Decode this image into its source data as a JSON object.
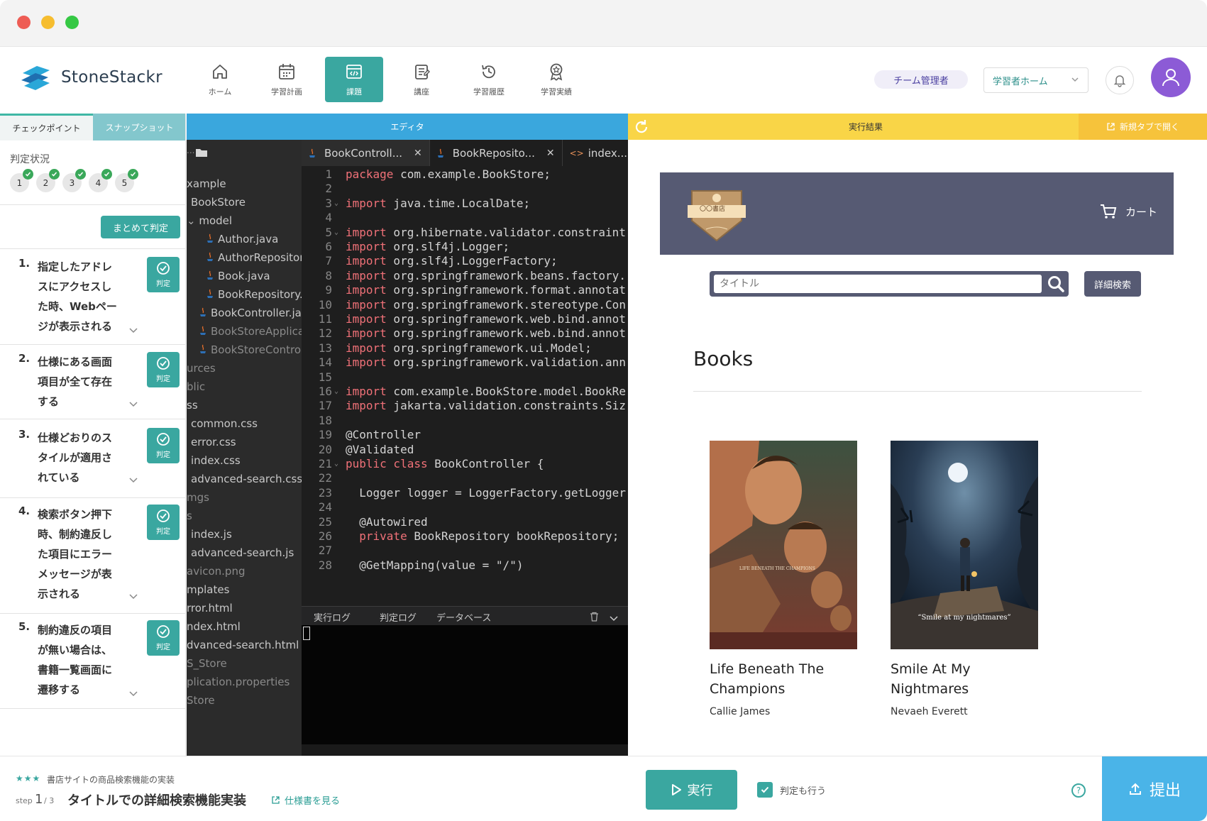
{
  "nav": {
    "logo_text": "StoneStackr",
    "items": [
      {
        "label": "ホーム",
        "icon": "home-icon"
      },
      {
        "label": "学習計画",
        "icon": "calendar-icon"
      },
      {
        "label": "課題",
        "icon": "code-window-icon",
        "active": true
      },
      {
        "label": "講座",
        "icon": "notebook-icon"
      },
      {
        "label": "学習履歴",
        "icon": "history-icon"
      },
      {
        "label": "学習実績",
        "icon": "award-icon"
      }
    ],
    "team_badge": "チーム管理者",
    "home_select": "学習者ホーム",
    "accent_color": "#3aa7a0"
  },
  "left_panel": {
    "tabs": [
      "チェックポイント",
      "スナップショット"
    ],
    "judge_status_label": "判定状況",
    "status_numbers": [
      "1",
      "2",
      "3",
      "4",
      "5"
    ],
    "batch_button": "まとめて判定",
    "judge_label": "判定",
    "checkpoints": [
      {
        "num": "1.",
        "lines": [
          "指定したアドレ",
          "スにアクセスし",
          "た時、Webペー",
          "ジが表示される"
        ]
      },
      {
        "num": "2.",
        "lines": [
          "仕様にある画面",
          "項目が全て存在",
          "する"
        ]
      },
      {
        "num": "3.",
        "lines": [
          "仕様どおりのス",
          "タイルが適用さ",
          "れている"
        ]
      },
      {
        "num": "4.",
        "lines": [
          "検索ボタン押下",
          "時、制約違反し",
          "た項目にエラー",
          "メッセージが表",
          "示される"
        ]
      },
      {
        "num": "5.",
        "lines": [
          "制約違反の項目",
          "が無い場合は、",
          "書籍一覧画面に",
          "遷移する"
        ]
      }
    ]
  },
  "editor": {
    "header": "エディタ",
    "tree": [
      "...",
      "xample",
      "BookStore",
      "model",
      "Author.java",
      "AuthorRepository.",
      "Book.java",
      "BookRepository.ja",
      "BookController.java",
      "BookStoreApplicati",
      "BookStoreControlle",
      "urces",
      "blic",
      "ss",
      "common.css",
      "error.css",
      "index.css",
      "advanced-search.css",
      "mgs",
      "s",
      "index.js",
      "advanced-search.js",
      "avicon.png",
      "mplates",
      "rror.html",
      "ndex.html",
      "dvanced-search.html",
      "S_Store",
      "plication.properties",
      "Store"
    ],
    "tabs": [
      {
        "label": "BookControll...",
        "type": "java"
      },
      {
        "label": "BookReposito...",
        "type": "java"
      },
      {
        "label": "index....",
        "type": "html"
      }
    ],
    "lines": [
      {
        "n": "1",
        "kw": "package",
        "rest": " com.example.BookStore;"
      },
      {
        "n": "2",
        "kw": "",
        "rest": ""
      },
      {
        "n": "3",
        "kw": "import",
        "rest": " java.time.LocalDate;",
        "fold": true
      },
      {
        "n": "4",
        "kw": "",
        "rest": ""
      },
      {
        "n": "5",
        "kw": "import",
        "rest": " org.hibernate.validator.constraint",
        "fold": true
      },
      {
        "n": "6",
        "kw": "import",
        "rest": " org.slf4j.Logger;"
      },
      {
        "n": "7",
        "kw": "import",
        "rest": " org.slf4j.LoggerFactory;"
      },
      {
        "n": "8",
        "kw": "import",
        "rest": " org.springframework.beans.factory."
      },
      {
        "n": "9",
        "kw": "import",
        "rest": " org.springframework.format.annotat"
      },
      {
        "n": "10",
        "kw": "import",
        "rest": " org.springframework.stereotype.Con"
      },
      {
        "n": "11",
        "kw": "import",
        "rest": " org.springframework.web.bind.annot"
      },
      {
        "n": "12",
        "kw": "import",
        "rest": " org.springframework.web.bind.annot"
      },
      {
        "n": "13",
        "kw": "import",
        "rest": " org.springframework.ui.Model;"
      },
      {
        "n": "14",
        "kw": "import",
        "rest": " org.springframework.validation.ann"
      },
      {
        "n": "15",
        "kw": "",
        "rest": ""
      },
      {
        "n": "16",
        "kw": "import",
        "rest": " com.example.BookStore.model.BookRe",
        "fold": true
      },
      {
        "n": "17",
        "kw": "import",
        "rest": " jakarta.validation.constraints.Siz"
      },
      {
        "n": "18",
        "kw": "",
        "rest": ""
      },
      {
        "n": "19",
        "kw": "",
        "rest": "@Controller"
      },
      {
        "n": "20",
        "kw": "",
        "rest": "@Validated"
      },
      {
        "n": "21",
        "kw": "public class",
        "rest": " BookController {",
        "fold": true
      },
      {
        "n": "22",
        "kw": "",
        "rest": ""
      },
      {
        "n": "23",
        "kw": "",
        "rest": "  Logger logger = LoggerFactory.getLogger"
      },
      {
        "n": "24",
        "kw": "",
        "rest": ""
      },
      {
        "n": "25",
        "kw": "",
        "rest": "  @Autowired"
      },
      {
        "n": "26",
        "kw": "  private",
        "rest": " BookRepository bookRepository;"
      },
      {
        "n": "27",
        "kw": "",
        "rest": ""
      },
      {
        "n": "28",
        "kw": "",
        "rest": "  @GetMapping(value = \"/\")"
      }
    ],
    "log_tabs": [
      "実行ログ",
      "判定ログ",
      "データベース"
    ]
  },
  "result": {
    "header": "実行結果",
    "new_tab": "新規タブで開く",
    "shop_logo_text": "〇〇書店",
    "cart_label": "カート",
    "search_placeholder": "タイトル",
    "advanced_search": "詳細検索",
    "books_heading": "Books",
    "books": [
      {
        "title_lines": [
          "Life Beneath The",
          "Champions"
        ],
        "author": "Callie James",
        "cover_text": "LIFE BENEATH THE CHAMPIONS"
      },
      {
        "title_lines": [
          "Smile At My",
          "Nightmares"
        ],
        "author": "Nevaeh Everett",
        "cover_text": "“Smile at my nightmares”"
      }
    ]
  },
  "bottom": {
    "stars": "★★★",
    "task_name": "書店サイトの商品検索機能の実装",
    "step_label": "step",
    "step_current": "1",
    "step_total": "/ 3",
    "step_title": "タイトルでの詳細検索機能実装",
    "spec_link": "仕様書を見る",
    "run_button": "実行",
    "judge_toggle": "判定も行う",
    "judge_toggle_checked": true,
    "help": "?",
    "submit_button": "提出"
  }
}
